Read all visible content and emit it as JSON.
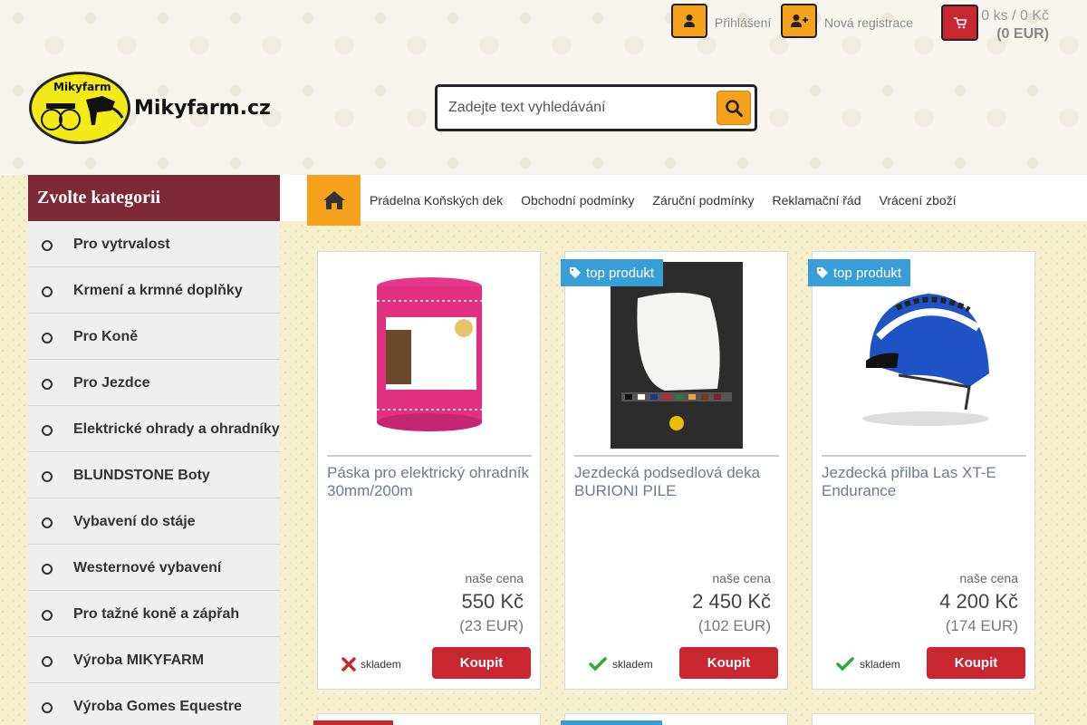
{
  "header": {
    "login_label": "Přihlášení",
    "register_label": "Nová registrace",
    "cart_summary": "0 ks / 0 Kč",
    "cart_eur": "(0 EUR)",
    "logo_badge_text": "Mikyfarm",
    "logo_text": "Mikyfarm.cz"
  },
  "search": {
    "placeholder": "Zadejte text vyhledávání"
  },
  "sidebar": {
    "title": "Zvolte kategorii",
    "items": [
      {
        "label": "Pro vytrvalost"
      },
      {
        "label": "Krmení a krmné doplňky"
      },
      {
        "label": "Pro Koně"
      },
      {
        "label": "Pro Jezdce"
      },
      {
        "label": "Elektrické ohrady a ohradníky"
      },
      {
        "label": "BLUNDSTONE Boty"
      },
      {
        "label": "Vybavení do stáje"
      },
      {
        "label": "Westernové vybavení"
      },
      {
        "label": "Pro tažné koně a zápřah"
      },
      {
        "label": "Výroba MIKYFARM"
      },
      {
        "label": "Výroba Gomes Equestre"
      }
    ]
  },
  "nav": {
    "links": [
      {
        "label": "Prádelna Koňských dek"
      },
      {
        "label": "Obchodní podmínky"
      },
      {
        "label": "Záruční podmínky"
      },
      {
        "label": "Reklamační řád"
      },
      {
        "label": "Vrácení zboží"
      }
    ]
  },
  "products": [
    {
      "title": "Páska pro elektrický ohradník 30mm/200m",
      "price_label": "naše cena",
      "price": "550 Kč",
      "price_eur": "(23 EUR)",
      "stock": "skladem",
      "buy": "Koupit",
      "badge": ""
    },
    {
      "title": "Jezdecká podsedlová deka BURIONI PILE",
      "price_label": "naše cena",
      "price": "2 450 Kč",
      "price_eur": "(102 EUR)",
      "stock": "skladem",
      "buy": "Koupit",
      "badge": "top produkt"
    },
    {
      "title": "Jezdecká přilba Las XT-E Endurance",
      "price_label": "naše cena",
      "price": "4 200 Kč",
      "price_eur": "(174 EUR)",
      "stock": "skladem",
      "buy": "Koupit",
      "badge": "top produkt"
    }
  ],
  "colors": {
    "accent_orange": "#f6a21c",
    "buy_red": "#c9272f",
    "category_header": "#7e2a36",
    "badge_blue": "#3a9ed6",
    "in_stock_green": "#2faa3b",
    "out_stock_red": "#d0222a"
  }
}
